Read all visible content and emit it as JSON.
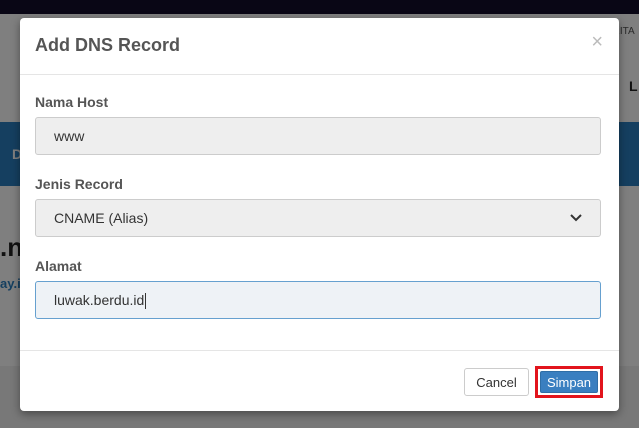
{
  "background": {
    "nav_text": "ERITA",
    "right_letter": "L",
    "banner_letter": "D",
    "domain_fragment": ".n",
    "domain_link_fragment": "ay.i"
  },
  "modal": {
    "title": "Add DNS Record",
    "close_symbol": "×",
    "fields": {
      "host": {
        "label": "Nama Host",
        "value": "www"
      },
      "record_type": {
        "label": "Jenis Record",
        "value": "CNAME (Alias)"
      },
      "address": {
        "label": "Alamat",
        "value": "luwak.berdu.id"
      }
    },
    "buttons": {
      "cancel": "Cancel",
      "save": "Simpan"
    }
  },
  "colors": {
    "primary": "#3a7fc0",
    "highlight": "#e2141c",
    "topbar": "#120d2b",
    "banner": "#2a7fc1"
  }
}
